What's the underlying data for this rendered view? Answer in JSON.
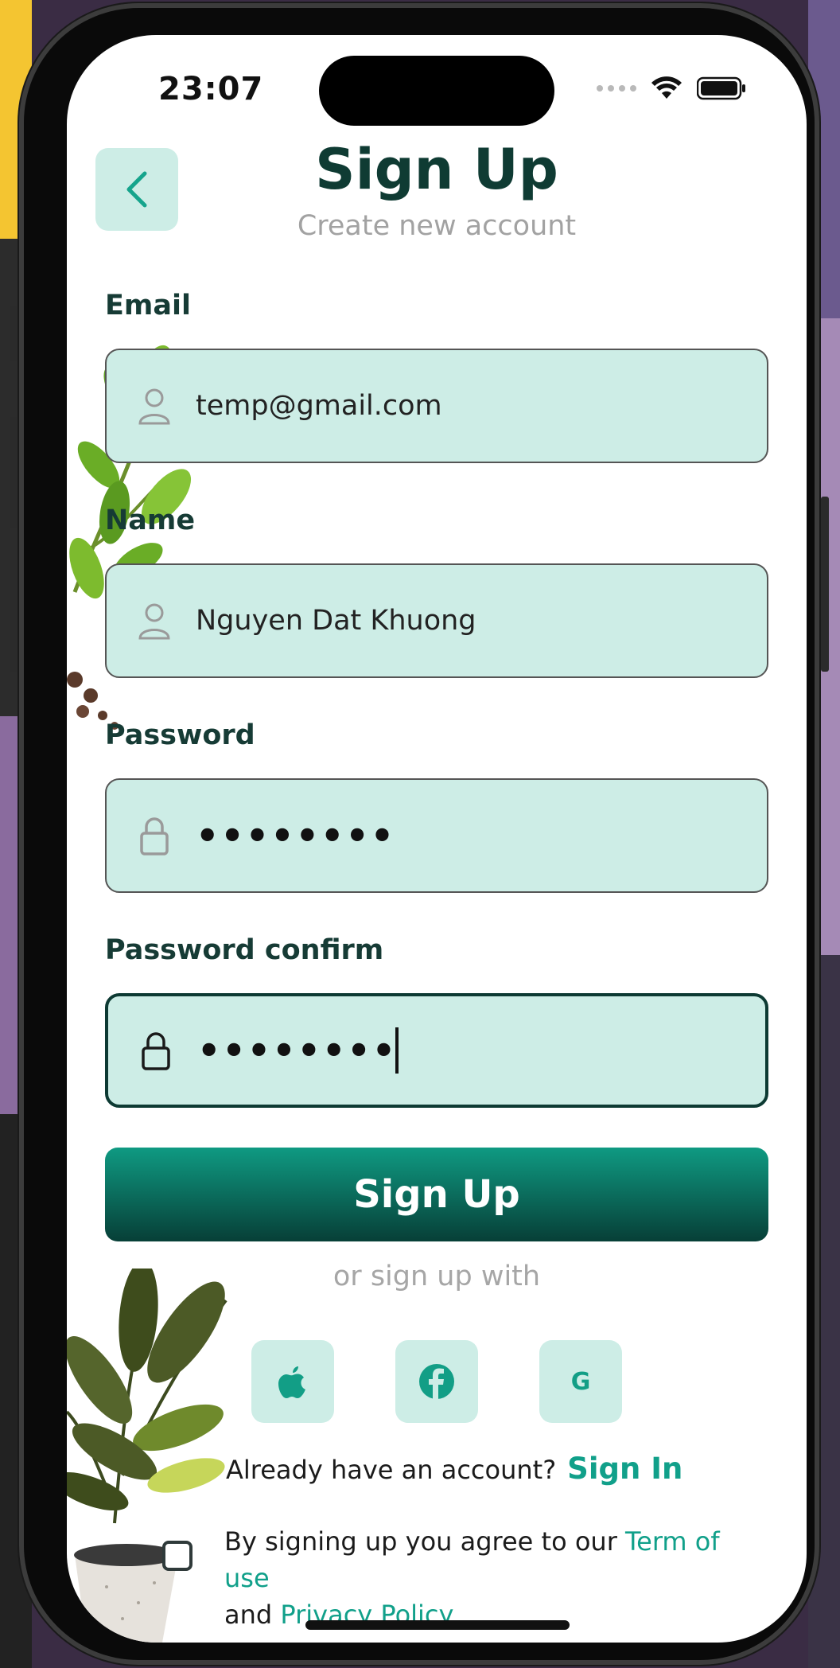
{
  "status": {
    "time": "23:07"
  },
  "header": {
    "title": "Sign Up",
    "subtitle": "Create new account"
  },
  "form": {
    "email": {
      "label": "Email",
      "value": "temp@gmail.com"
    },
    "name": {
      "label": "Name",
      "value": "Nguyen Dat Khuong"
    },
    "password": {
      "label": "Password",
      "value": "••••••••"
    },
    "password_confirm": {
      "label": "Password confirm",
      "value": "••••••••"
    }
  },
  "actions": {
    "signup_label": "Sign Up",
    "or_text": "or sign up with"
  },
  "social": {
    "google_label": "G"
  },
  "footer": {
    "already_text": "Already have an account?",
    "signin_link": "Sign In",
    "terms_prefix": "By signing up you agree to our",
    "terms_link": "Term of use",
    "terms_and": "and",
    "privacy_link": "Privacy Policy"
  },
  "colors": {
    "accent": "#11a08a",
    "field_bg": "#cdede6",
    "title": "#0f3b33"
  }
}
